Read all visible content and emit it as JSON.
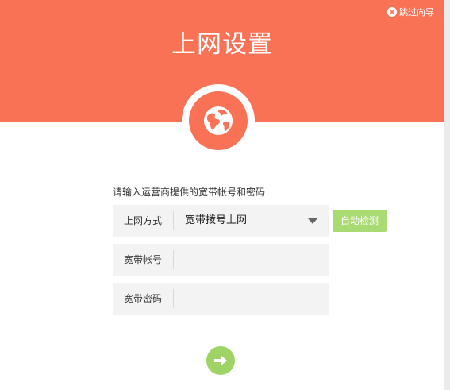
{
  "header": {
    "title": "上网设置",
    "skip_label": "跳过向导",
    "skip_icon": "close-circle-icon",
    "badge_icon": "globe-icon"
  },
  "form": {
    "prompt": "请输入运营商提供的宽带帐号和密码",
    "connection_type": {
      "label": "上网方式",
      "value": "宽带拨号上网",
      "icon": "chevron-down-icon"
    },
    "account": {
      "label": "宽带帐号",
      "value": ""
    },
    "password": {
      "label": "宽带密码",
      "value": ""
    },
    "detect_button": "自动检测",
    "next_icon": "arrow-right-icon"
  },
  "colors": {
    "brand": "#fa7255",
    "accent_green": "#9fd366",
    "field_bg": "#f3f3f3"
  }
}
